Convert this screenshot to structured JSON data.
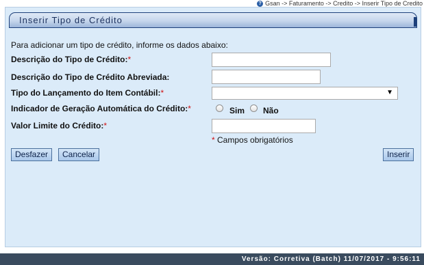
{
  "breadcrumb": {
    "text": "Gsan -> Faturamento -> Credito -> Inserir Tipo de Credito",
    "icon": "help-icon"
  },
  "panel": {
    "title": "Inserir Tipo de Crédito"
  },
  "form": {
    "intro": "Para adicionar um tipo de crédito, informe os dados abaixo:",
    "descricao": {
      "label": "Descrição do Tipo de Crédito:",
      "required_mark": "*",
      "value": ""
    },
    "descricao_abreviada": {
      "label": "Descrição do Tipo de Crédito Abreviada:",
      "value": ""
    },
    "tipo_lancamento": {
      "label": "Tipo do Lançamento do Item Contábil:",
      "required_mark": "*",
      "selected": ""
    },
    "indicador_geracao": {
      "label": "Indicador de Geração Automática do Crédito:",
      "required_mark": "*",
      "option_sim": "Sim",
      "option_nao": "Não"
    },
    "valor_limite": {
      "label": "Valor Limite do Crédito:",
      "required_mark": "*",
      "value": ""
    },
    "required_note_mark": "*",
    "required_note": "Campos obrigatórios"
  },
  "buttons": {
    "desfazer": "Desfazer",
    "cancelar": "Cancelar",
    "inserir": "Inserir"
  },
  "footer": {
    "version": "Versão: Corretiva (Batch) 11/07/2017 - 9:56:11"
  },
  "colors": {
    "panel_bg": "#dbebf9",
    "title_border": "#1c3f7a",
    "footer_bg": "#3a4b5e",
    "required": "#d01010"
  }
}
